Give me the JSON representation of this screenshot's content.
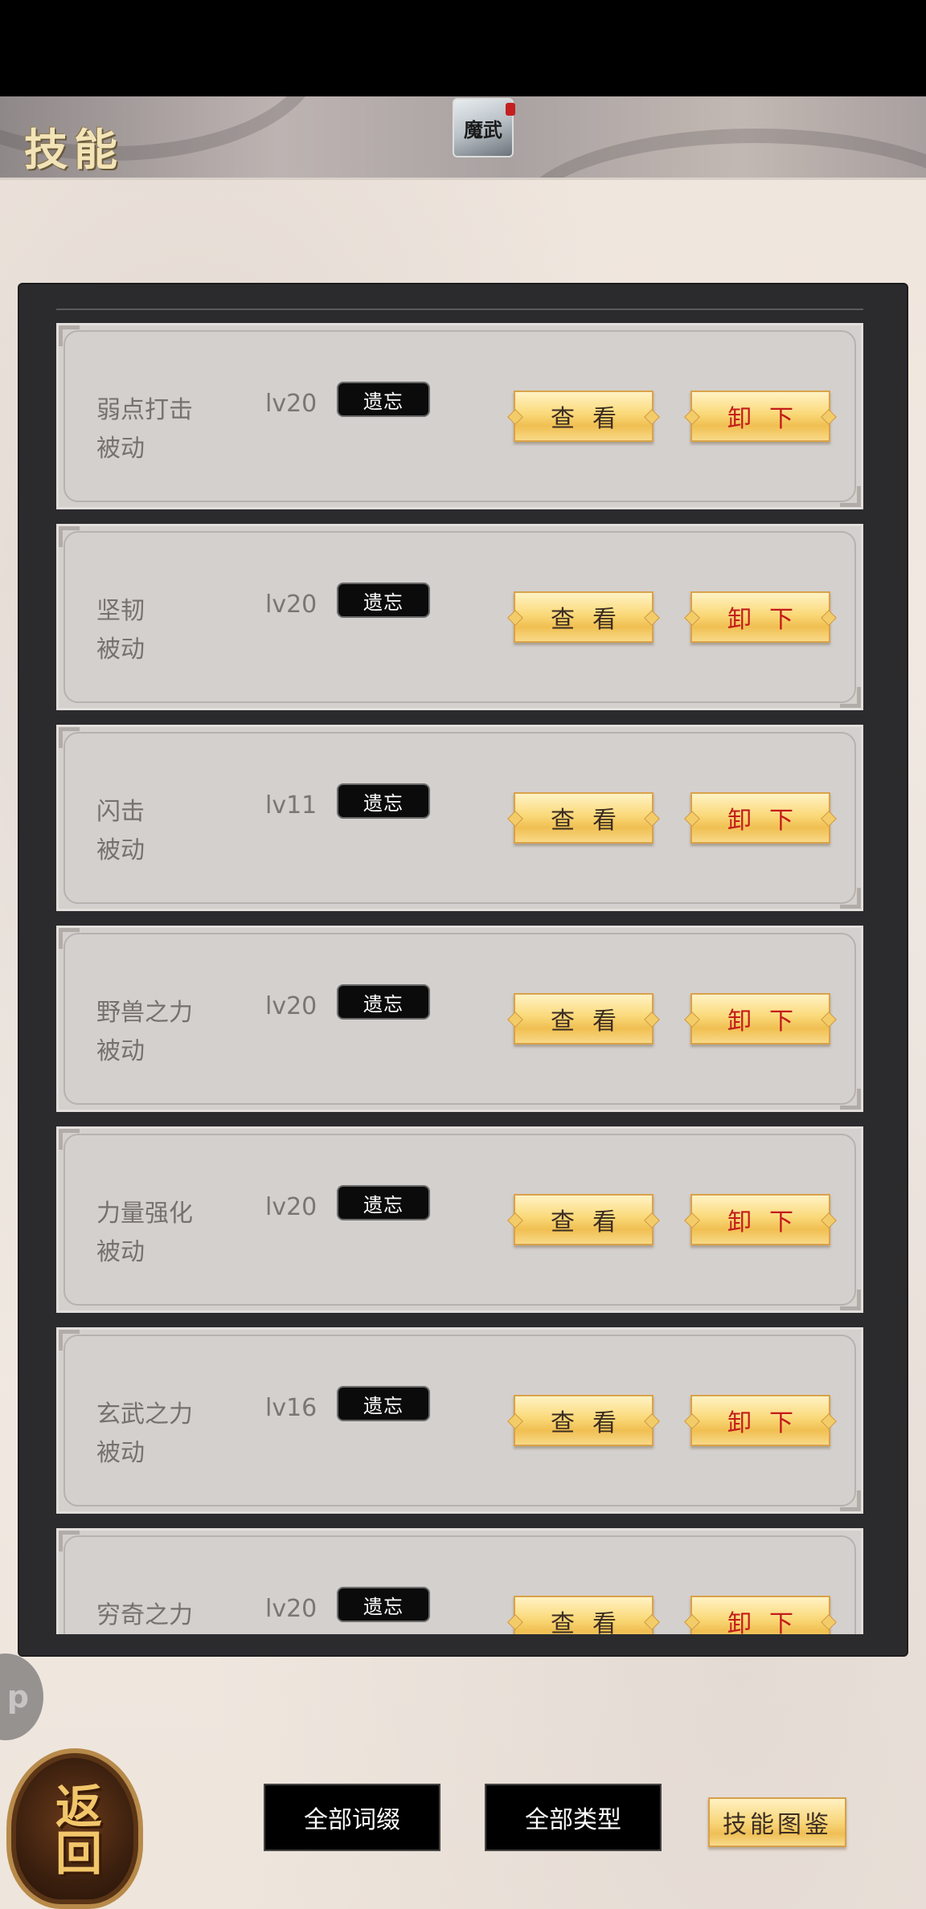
{
  "header": {
    "title": "技能",
    "logo_text": "魔武"
  },
  "skills": [
    {
      "name": "弱点打击",
      "type": "被动",
      "level": "lv20",
      "forget_label": "遗忘",
      "view_label": "查看",
      "unload_label": "卸下"
    },
    {
      "name": "坚韧",
      "type": "被动",
      "level": "lv20",
      "forget_label": "遗忘",
      "view_label": "查看",
      "unload_label": "卸下"
    },
    {
      "name": "闪击",
      "type": "被动",
      "level": "lv11",
      "forget_label": "遗忘",
      "view_label": "查看",
      "unload_label": "卸下"
    },
    {
      "name": "野兽之力",
      "type": "被动",
      "level": "lv20",
      "forget_label": "遗忘",
      "view_label": "查看",
      "unload_label": "卸下"
    },
    {
      "name": "力量强化",
      "type": "被动",
      "level": "lv20",
      "forget_label": "遗忘",
      "view_label": "查看",
      "unload_label": "卸下"
    },
    {
      "name": "玄武之力",
      "type": "被动",
      "level": "lv16",
      "forget_label": "遗忘",
      "view_label": "查看",
      "unload_label": "卸下"
    },
    {
      "name": "穷奇之力",
      "type": "",
      "level": "lv20",
      "forget_label": "遗忘",
      "view_label": "查看",
      "unload_label": "卸下"
    }
  ],
  "floating": {
    "app_bubble_text": "p",
    "return_emblem_text": "返回"
  },
  "footer": {
    "filter_affix_label": "全部词缀",
    "filter_type_label": "全部类型",
    "atlas_label": "技能图鉴"
  },
  "colors": {
    "accent_gold": "#f8d67a",
    "unload_red": "#c31b1b",
    "panel_dark": "#2b2b2e"
  }
}
